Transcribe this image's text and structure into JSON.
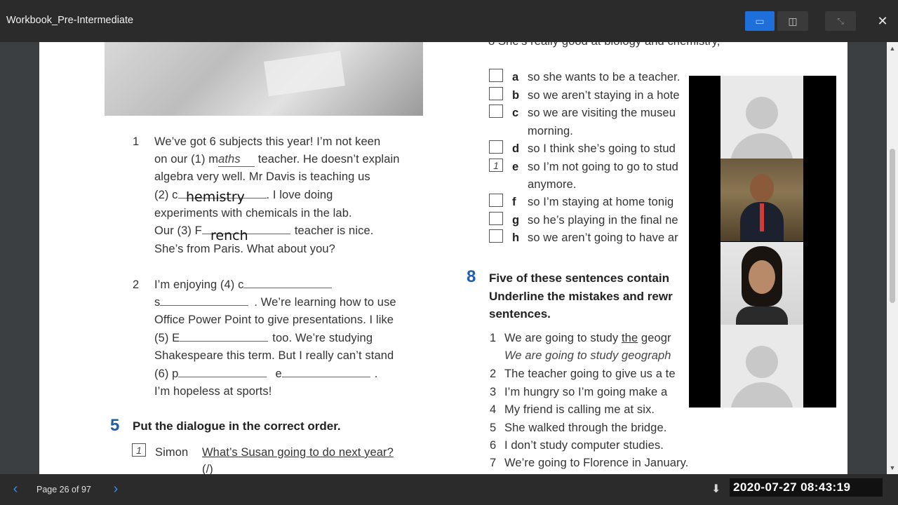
{
  "window": {
    "title": "Workbook_Pre-Intermediate",
    "close_glyph": "✕",
    "layout_single_glyph": "▭",
    "layout_split_glyph": "◫",
    "shrink_glyph": "⤡"
  },
  "left_column": {
    "item1": {
      "num": "1",
      "l1": "We’ve got 6 subjects this year! I’m not keen",
      "l2_pre": "on our (1) m",
      "l2_ans": "aths",
      "l2_post": " teacher. He doesn’t explain",
      "l3": "algebra very well. Mr Davis is teaching us",
      "l4_pre": "(2) c",
      "l4_post": ". I love doing",
      "l5": "experiments with chemicals in the lab.",
      "l6_pre": "Our (3) F",
      "l6_post": "teacher is nice.",
      "l7": "She’s from Paris. What about you?",
      "hand_chem": "hemistry",
      "hand_french": "rench"
    },
    "item2": {
      "num": "2",
      "l1": "I’m enjoying (4) c",
      "l2_pre": "s",
      "l2_post": ". We’re learning how to use",
      "l3": "Office Power Point to give presentations. I like",
      "l4_pre": "(5) E",
      "l4_post": "too. We’re studying",
      "l5": "Shakespeare this term. But I really can’t stand",
      "l6_pre": "(6) p",
      "l6_mid": "e",
      "l6_post": ".",
      "l7": "I’m hopeless at sports!"
    },
    "exercise5": {
      "num": "5",
      "heading": "Put the dialogue in the correct order.",
      "box_mark": "1",
      "speaker": "Simon",
      "line": "What’s Susan going to do next year?",
      "sub": "(/)"
    }
  },
  "right_column": {
    "cut_line": "8  She’s really good at biology and chemistry,",
    "options": [
      {
        "letter": "a",
        "mark": "",
        "text": "so she wants to be a teacher.",
        "cont": ""
      },
      {
        "letter": "b",
        "mark": "",
        "text": "so we aren’t staying in a hote",
        "cont": ""
      },
      {
        "letter": "c",
        "mark": "",
        "text": "so we are visiting the museu",
        "cont": "morning."
      },
      {
        "letter": "d",
        "mark": "",
        "text": "so I think she’s going to stud",
        "cont": ""
      },
      {
        "letter": "e",
        "mark": "1",
        "text": "so I’m not going to go to stud",
        "cont": "anymore."
      },
      {
        "letter": "f",
        "mark": "",
        "text": "so I’m staying at home tonig",
        "cont": ""
      },
      {
        "letter": "g",
        "mark": "",
        "text": "so he’s playing in the final ne",
        "cont": ""
      },
      {
        "letter": "h",
        "mark": "",
        "text": "so we aren’t going to have ar",
        "cont": ""
      }
    ],
    "exercise8": {
      "num": "8",
      "heading_l1": "Five of these sentences contain",
      "heading_l2": "Underline the mistakes and rewr",
      "heading_l3": "sentences.",
      "s1_pre": "We are going to study ",
      "s1_ul": "the",
      "s1_post": " geogr",
      "s1_fix": "We are going to study geograph",
      "sentences": [
        {
          "n": "2",
          "t": "The teacher going to give us a te"
        },
        {
          "n": "3",
          "t": "I’m hungry so I’m going make a"
        },
        {
          "n": "4",
          "t": "My friend is calling me at six."
        },
        {
          "n": "5",
          "t": "She walked through the bridge."
        },
        {
          "n": "6",
          "t": "I don’t study computer studies."
        },
        {
          "n": "7",
          "t": "We’re going to Florence in January."
        }
      ]
    }
  },
  "bottom": {
    "prev_glyph": "‹",
    "next_glyph": "›",
    "page_info": "Page 26 of 97",
    "download_glyph": "⬇",
    "timestamp": "2020-07-27  08:43:19"
  },
  "colors": {
    "accent_blue": "#1e6fd9",
    "nav_blue": "#3b8de8",
    "exercise_number_blue": "#1f5fa8"
  }
}
